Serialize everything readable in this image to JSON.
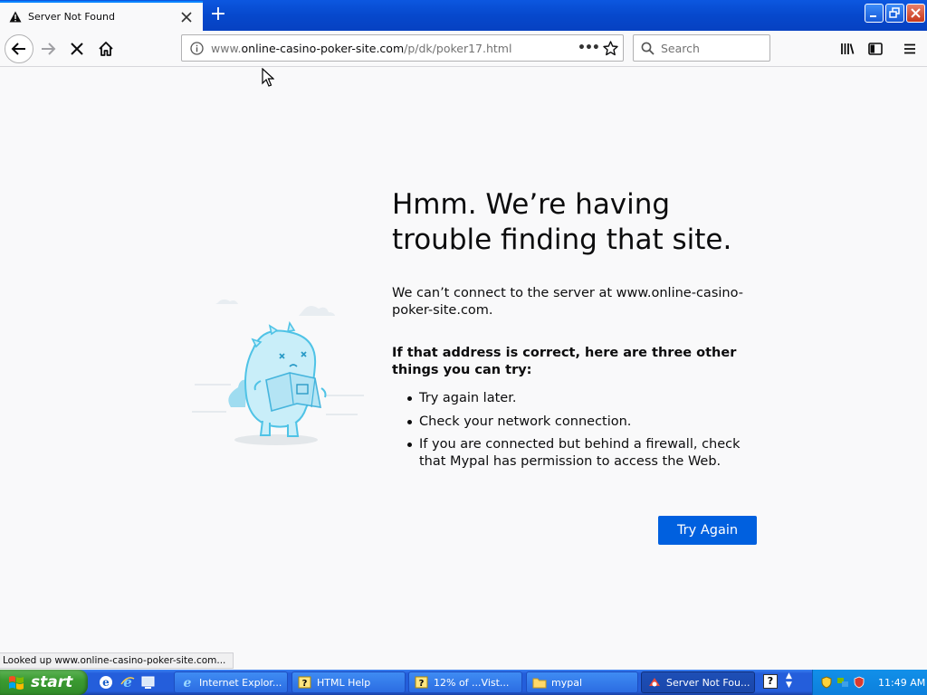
{
  "browser": {
    "tab_title": "Server Not Found",
    "new_tab_symbol": "+",
    "url_prefix": "www.",
    "url_host": "online-casino-poker-site.com",
    "url_path": "/p/dk/poker17.html",
    "search_placeholder": "Search",
    "page_actions_symbol": "•••",
    "status_text": "Looked up www.online-casino-poker-site.com..."
  },
  "error_page": {
    "title": "Hmm. We’re having trouble finding that site.",
    "description": "We can’t connect to the server at www.online-casino-poker-site.com.",
    "suggestions_heading": "If that address is correct, here are three other things you can try:",
    "suggestions": [
      "Try again later.",
      "Check your network connection.",
      "If you are connected but behind a firewall, check that Mypal has permission to access the Web."
    ],
    "try_again_label": "Try Again"
  },
  "taskbar": {
    "start_label": "start",
    "buttons": [
      {
        "label": "Internet Explor...",
        "icon": "ie-icon"
      },
      {
        "label": "HTML Help",
        "icon": "help-icon"
      },
      {
        "label": "12% of ...Vist...",
        "icon": "help-icon"
      },
      {
        "label": "mypal",
        "icon": "folder-icon"
      },
      {
        "label": "Server Not Fou...",
        "icon": "mypal-icon"
      }
    ],
    "help_symbol": "?",
    "clock": "11:49 AM"
  },
  "colors": {
    "accent": "#0060df",
    "taskbar_blue": "#245edb",
    "start_green": "#3c9b32",
    "tray_blue": "#0c7fdc"
  }
}
